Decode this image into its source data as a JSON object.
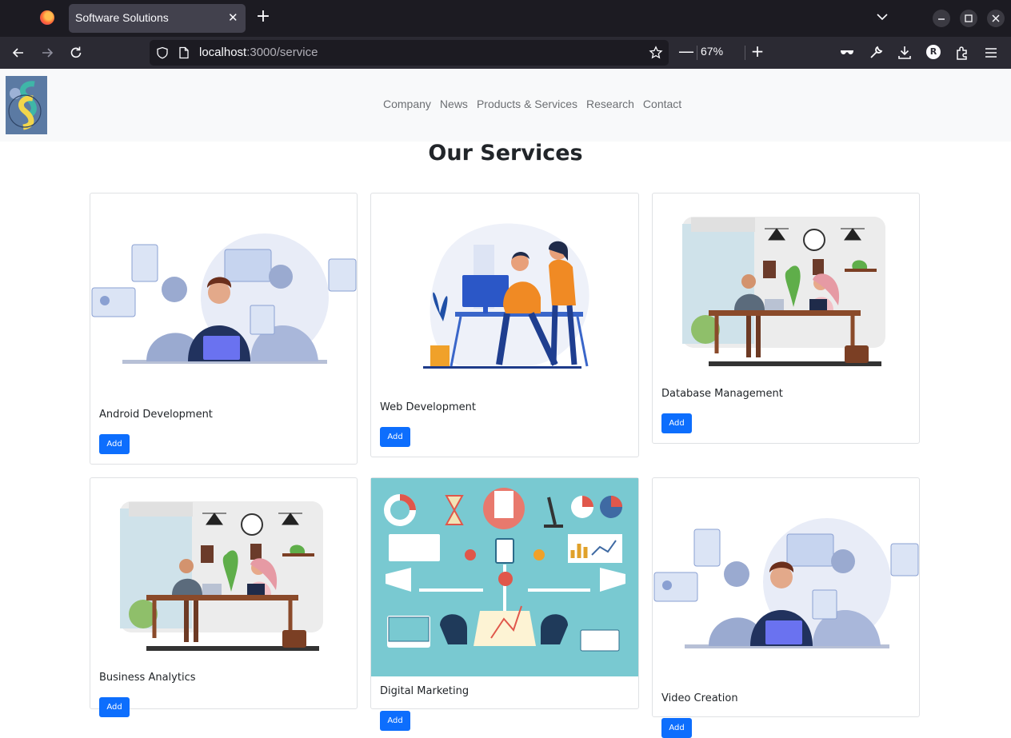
{
  "browser": {
    "tab_title": "Software Solutions",
    "url_host": "localhost",
    "url_rest": ":3000/service",
    "zoom": "67%",
    "profile_initial": "R",
    "zoom_minus": "—",
    "zoom_plus": "+",
    "new_tab": "+",
    "tab_close": "✕"
  },
  "site": {
    "nav": [
      "Company",
      "News",
      "Products & Services",
      "Research",
      "Contact"
    ],
    "page_title": "Our Services"
  },
  "services": [
    {
      "title": "Android Development",
      "button": "Add"
    },
    {
      "title": "Web Development",
      "button": "Add"
    },
    {
      "title": "Database Management",
      "button": "Add"
    },
    {
      "title": "Business Analytics",
      "button": "Add"
    },
    {
      "title": "Digital Marketing",
      "button": "Add"
    },
    {
      "title": "Video Creation",
      "button": "Add"
    }
  ],
  "colors": {
    "accent": "#0d6efd",
    "header_bg": "#f8f9fa",
    "chrome_dark": "#1c1b22",
    "marketing_bg": "#79c9d1"
  },
  "icons": {
    "back": "back-arrow-icon",
    "forward": "forward-arrow-icon",
    "reload": "reload-icon",
    "shield": "shield-icon",
    "bookmark": "star-icon",
    "downloads": "download-icon"
  }
}
